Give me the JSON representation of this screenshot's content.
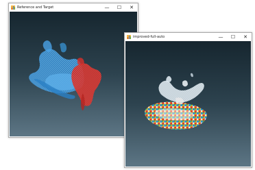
{
  "windows": [
    {
      "title": "Reference and Target",
      "controls": {
        "minimize": "—",
        "maximize": "☐",
        "close": "✕"
      },
      "icon": "matlab-figure-icon"
    },
    {
      "title": "improved-full-auto",
      "controls": {
        "minimize": "—",
        "maximize": "☐",
        "close": "✕"
      },
      "icon": "matlab-figure-icon"
    }
  ],
  "colors": {
    "background_top": "#16262f",
    "background_bottom": "#5d7685",
    "reference_cloud": "#3a9be0",
    "target_cloud": "#d9302a"
  }
}
